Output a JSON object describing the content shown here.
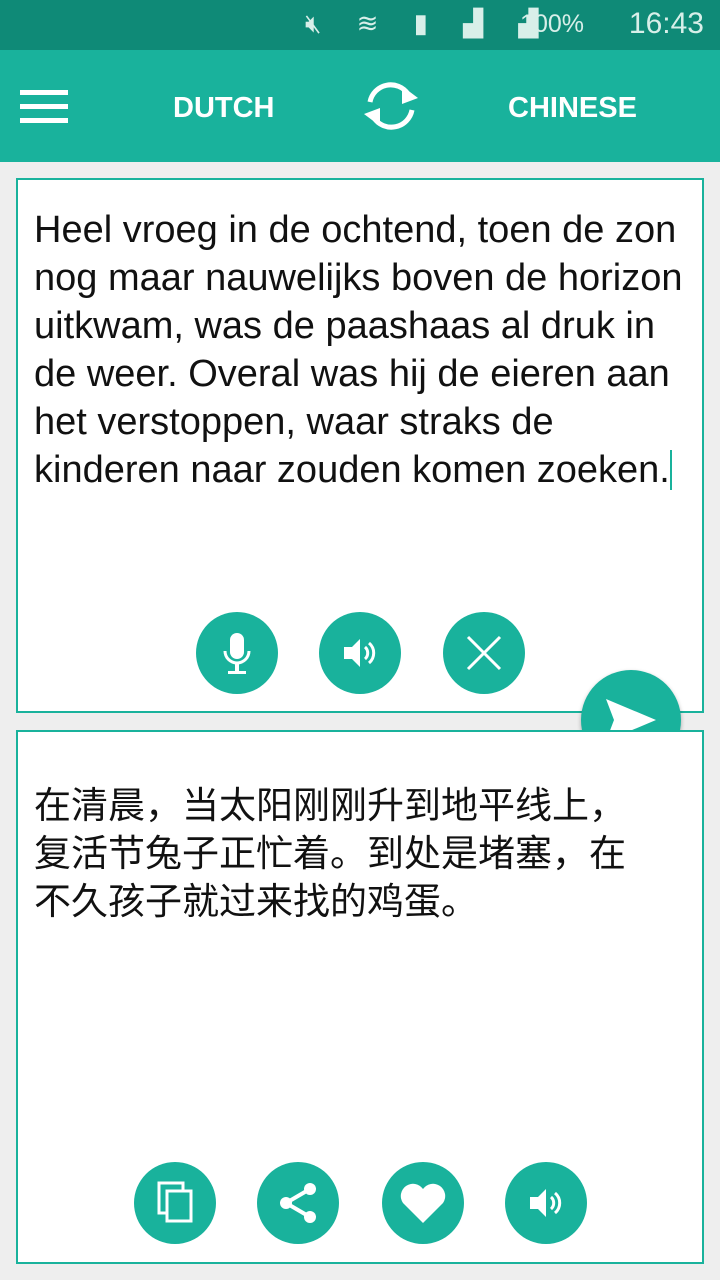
{
  "status_bar": {
    "battery": "100%",
    "time": "16:43",
    "icons": [
      "mute-icon",
      "wifi-icon",
      "sim-icon",
      "signal-icon",
      "signal-icon",
      "battery-charging-icon"
    ]
  },
  "toolbar": {
    "source_language": "DUTCH",
    "target_language": "CHINESE"
  },
  "source": {
    "text": "Heel vroeg in de ochtend, toen de zon nog maar nauwelijks boven de horizon uitkwam, was de paashaas al druk in de weer. Overal was hij de eieren aan het verstoppen, waar straks de kinderen naar zouden komen zoeken."
  },
  "target": {
    "text": "在清晨，当太阳刚刚升到地平线上，复活节兔子正忙着。到处是堵塞，在不久孩子就过来找的鸡蛋。"
  },
  "colors": {
    "accent": "#19b29c",
    "status": "#0f8a77"
  }
}
